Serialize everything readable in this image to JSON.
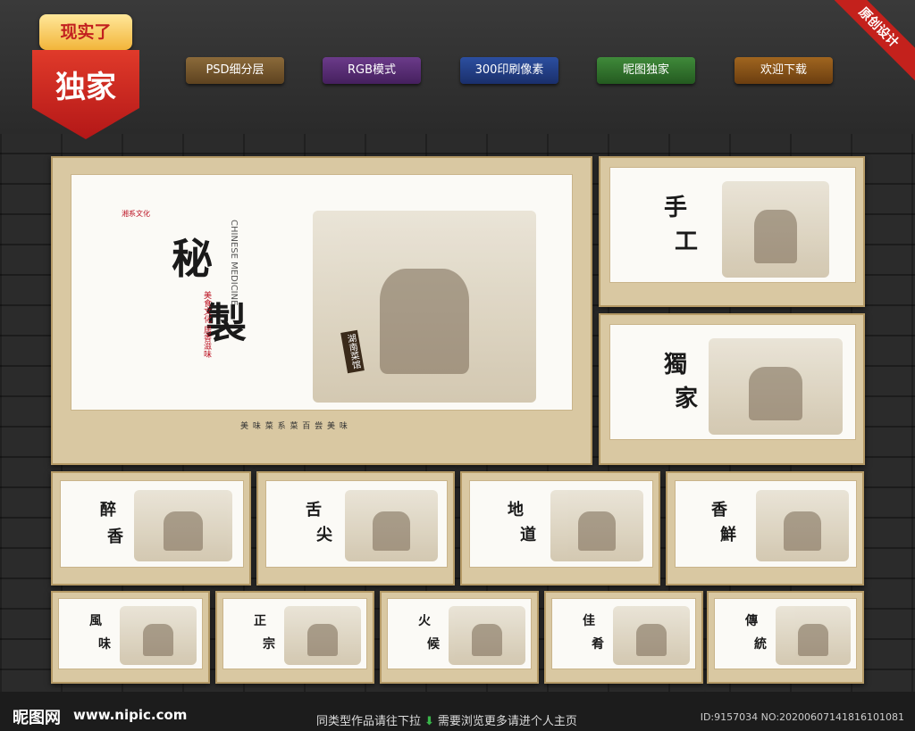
{
  "badge": {
    "top_label": "现实了",
    "main_label": "独家"
  },
  "corner_ribbon": "原创设计",
  "tags": [
    "PSD细分层",
    "RGB模式",
    "300印刷像素",
    "昵图独家",
    "欢迎下载"
  ],
  "main_poster": {
    "title_1": "秘",
    "title_2": "製",
    "vertical_en": "CHINESE MEDICINE",
    "seal_left": "湘系文化",
    "seal_mid": "美食文化 居香滋味",
    "sign": "湖南菜馆",
    "footer": "美 味 菜 系  菜  百 尝 美 味"
  },
  "side_posters": [
    {
      "title_1": "手",
      "title_2": "工"
    },
    {
      "title_1": "獨",
      "title_2": "家"
    }
  ],
  "row2": [
    {
      "title_1": "醉",
      "title_2": "香"
    },
    {
      "title_1": "舌",
      "title_2": "尖"
    },
    {
      "title_1": "地",
      "title_2": "道"
    },
    {
      "title_1": "香",
      "title_2": "鮮"
    }
  ],
  "row3": [
    {
      "title_1": "風",
      "title_2": "味"
    },
    {
      "title_1": "正",
      "title_2": "宗"
    },
    {
      "title_1": "火",
      "title_2": "候"
    },
    {
      "title_1": "佳",
      "title_2": "肴"
    },
    {
      "title_1": "傳",
      "title_2": "統"
    }
  ],
  "bottom": {
    "logo": "昵图网",
    "url": "www.nipic.com",
    "hint_1": "同类型作品请往下拉",
    "hint_2": "需要浏览更多请进个人主页",
    "id": "ID:9157034 NO:20200607141816101081"
  }
}
